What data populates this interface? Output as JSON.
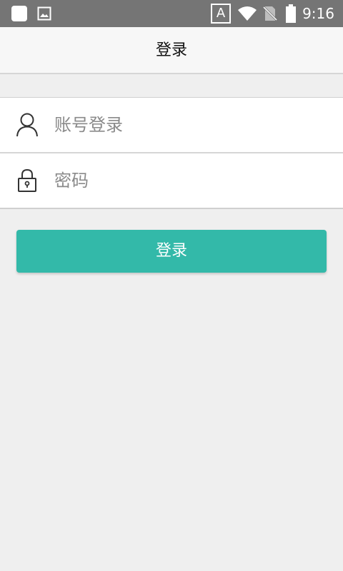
{
  "status_bar": {
    "time": "9:16",
    "a_indicator": "A",
    "icons": [
      "app-square-icon",
      "image-icon",
      "a-indicator-icon",
      "wifi-icon",
      "no-sim-icon",
      "battery-icon"
    ]
  },
  "header": {
    "title": "登录"
  },
  "form": {
    "account": {
      "placeholder": "账号登录",
      "icon": "user-icon"
    },
    "password": {
      "placeholder": "密码",
      "icon": "lock-icon"
    }
  },
  "login_button": {
    "label": "登录"
  },
  "colors": {
    "status_bar": "#757575",
    "header_bg": "#f7f7f7",
    "page_bg": "#efefef",
    "accent": "#33b9a9"
  }
}
